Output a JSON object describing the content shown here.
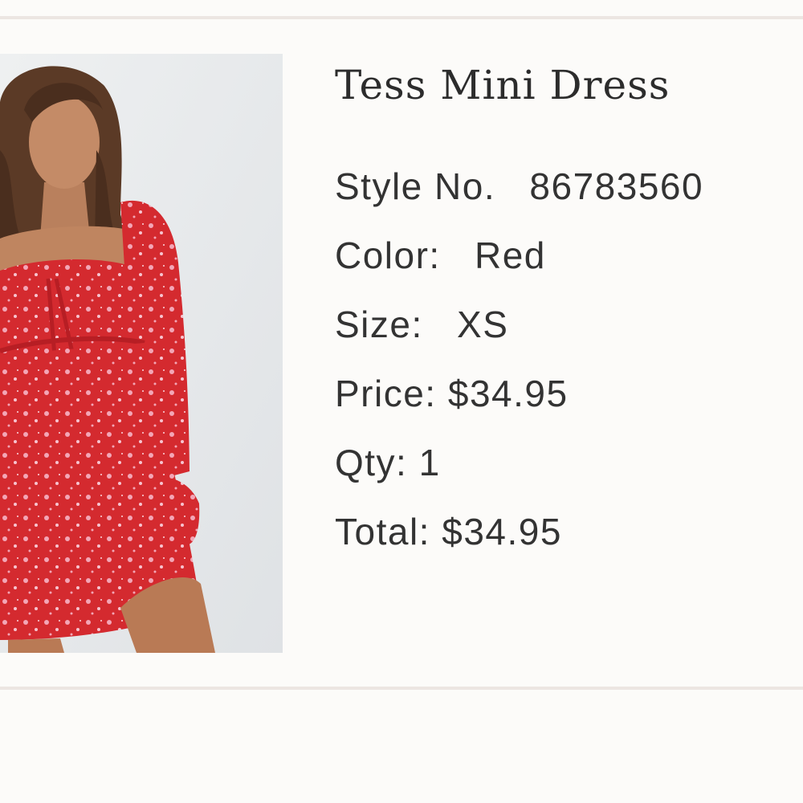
{
  "product": {
    "name": "Tess Mini Dress",
    "image_alt": "model-wearing-red-floral-mini-dress",
    "details": {
      "style_label": "Style No.",
      "style_value": "86783560",
      "color_label": "Color:",
      "color_value": "Red",
      "size_label": "Size:",
      "size_value": "XS",
      "price_label": "Price:",
      "price_value": "$34.95",
      "qty_label": "Qty:",
      "qty_value": "1",
      "total_label": "Total:",
      "total_value": "$34.95"
    }
  },
  "colors": {
    "background": "#fcfbf9",
    "divider": "#ece6e2",
    "text": "#333333",
    "dress": "#d42a2f"
  }
}
